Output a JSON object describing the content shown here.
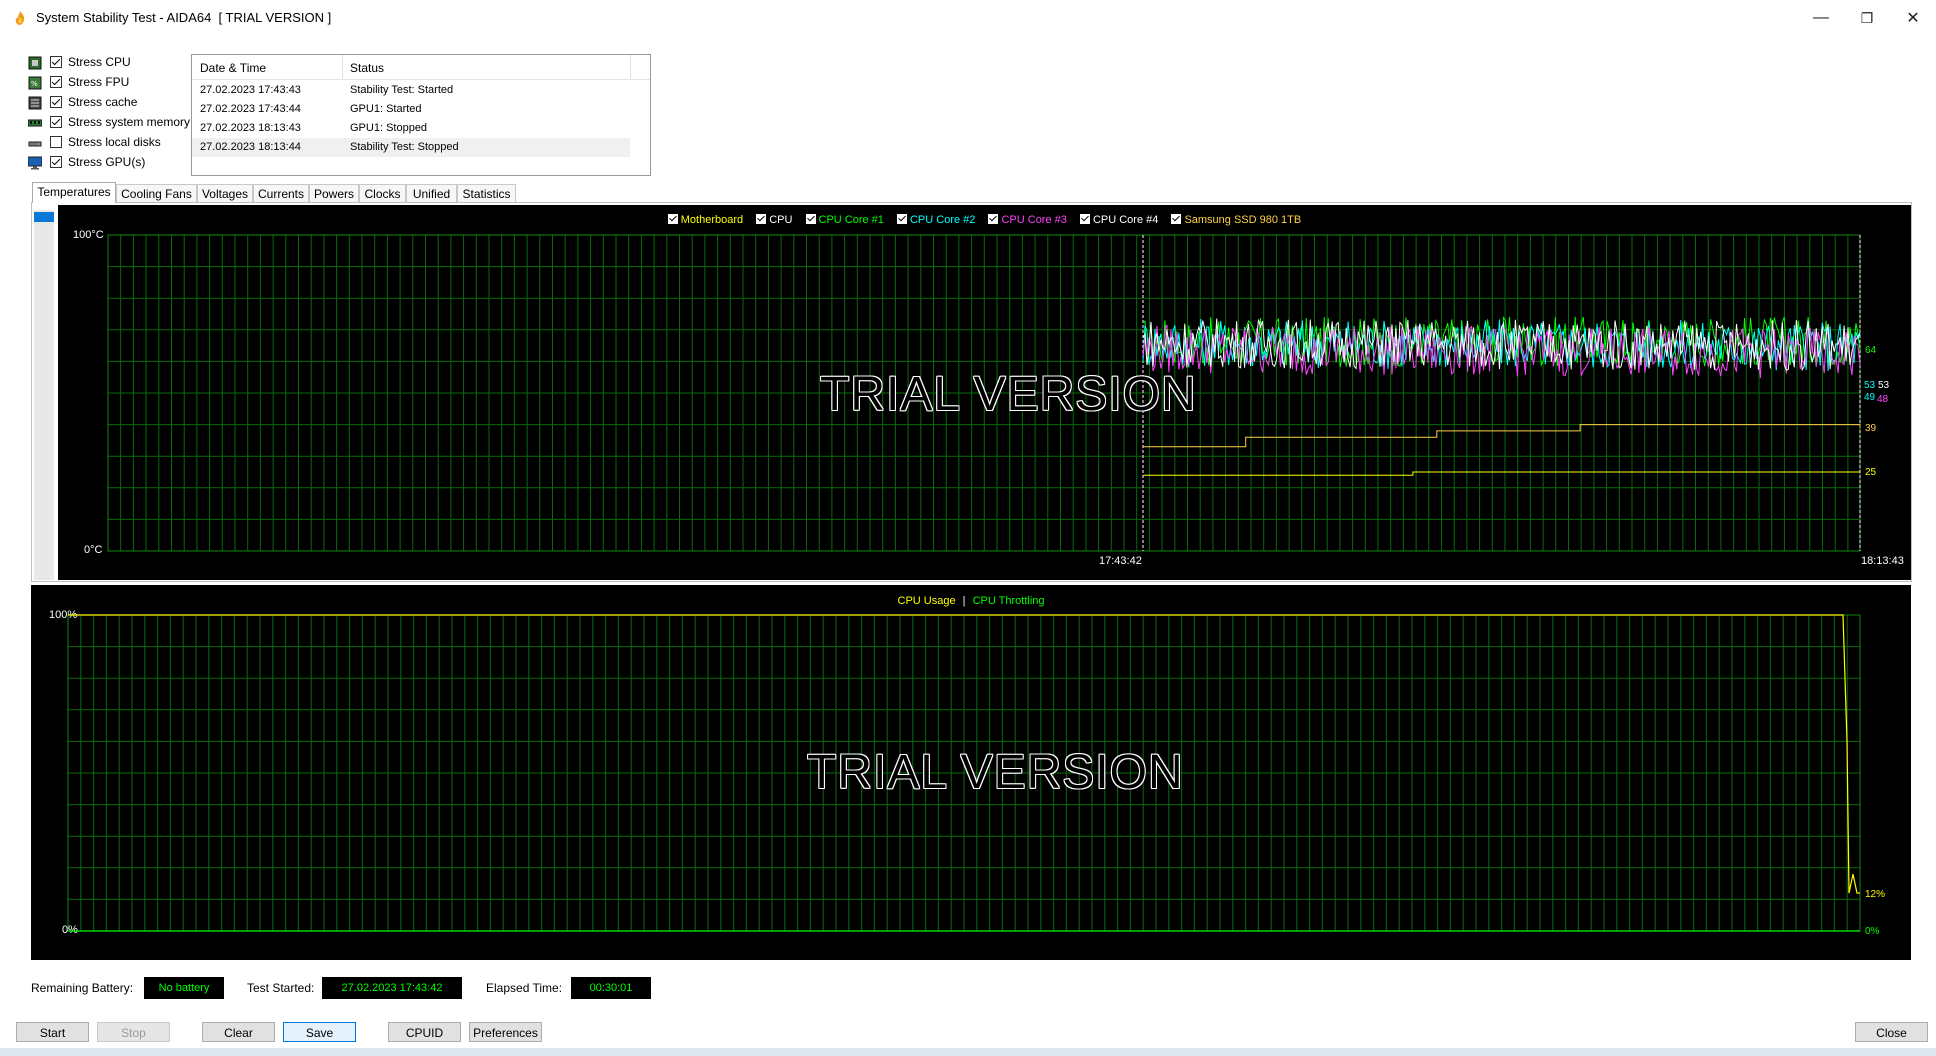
{
  "window": {
    "title": "System Stability Test - AIDA64  [ TRIAL VERSION ]",
    "minimize_glyph": "—",
    "maximize_glyph": "❐",
    "close_glyph": "✕"
  },
  "stress_options": [
    {
      "label": "Stress CPU",
      "checked": true,
      "icon": "cpu-chip-icon"
    },
    {
      "label": "Stress FPU",
      "checked": true,
      "icon": "fpu-chip-icon"
    },
    {
      "label": "Stress cache",
      "checked": true,
      "icon": "cache-chip-icon"
    },
    {
      "label": "Stress system memory",
      "checked": true,
      "icon": "memory-module-icon"
    },
    {
      "label": "Stress local disks",
      "checked": false,
      "icon": "disk-drive-icon"
    },
    {
      "label": "Stress GPU(s)",
      "checked": true,
      "icon": "monitor-gpu-icon"
    }
  ],
  "log": {
    "col_datetime": "Date & Time",
    "col_status": "Status",
    "rows": [
      {
        "datetime": "27.02.2023 17:43:43",
        "status": "Stability Test: Started"
      },
      {
        "datetime": "27.02.2023 17:43:44",
        "status": "GPU1: Started"
      },
      {
        "datetime": "27.02.2023 18:13:43",
        "status": "GPU1: Stopped"
      },
      {
        "datetime": "27.02.2023 18:13:44",
        "status": "Stability Test: Stopped"
      }
    ]
  },
  "tabs": [
    "Temperatures",
    "Cooling Fans",
    "Voltages",
    "Currents",
    "Powers",
    "Clocks",
    "Unified",
    "Statistics"
  ],
  "temp_graph": {
    "legend": [
      {
        "label": "Motherboard",
        "color": "#ffff00"
      },
      {
        "label": "CPU",
        "color": "#ffffff"
      },
      {
        "label": "CPU Core #1",
        "color": "#00ff00"
      },
      {
        "label": "CPU Core #2",
        "color": "#00ffff"
      },
      {
        "label": "CPU Core #3",
        "color": "#ff44ff"
      },
      {
        "label": "CPU Core #4",
        "color": "#ffffff"
      },
      {
        "label": "Samsung SSD 980 1TB",
        "color": "#ffd24a"
      }
    ],
    "y_top": "100°C",
    "y_bottom": "0°C",
    "x_start_time": "17:43:42",
    "x_end_time": "18:13:43",
    "watermark": "TRIAL VERSION",
    "end_values": [
      {
        "text": "64",
        "color": "#00ff00"
      },
      {
        "text": "53",
        "color": "#00ffff"
      },
      {
        "text": "53",
        "color": "#ffffff"
      },
      {
        "text": "49",
        "color": "#00ffff"
      },
      {
        "text": "48",
        "color": "#ff44ff"
      },
      {
        "text": "39",
        "color": "#ffd24a"
      },
      {
        "text": "25",
        "color": "#ffff00"
      }
    ]
  },
  "usage_graph": {
    "legend_usage": "CPU Usage",
    "legend_separator": "|",
    "legend_throttling": "CPU Throttling",
    "usage_color": "#ffff00",
    "throttling_color": "#00ff00",
    "y_top": "100%",
    "y_bottom": "0%",
    "watermark": "TRIAL VERSION",
    "end_usage": "12%",
    "end_throttling": "0%"
  },
  "chart_data": [
    {
      "type": "line",
      "y_unit": "°C",
      "ylim": [
        0,
        100
      ],
      "x_start": "17:43:42",
      "x_end": "18:13:43",
      "series": [
        {
          "name": "CPU Core #1",
          "color": "#00ff00",
          "x": [
            "17:43:42",
            "18:13:43"
          ],
          "values": [
            60,
            64
          ]
        },
        {
          "name": "CPU Core #2",
          "color": "#00ffff",
          "x": [
            "17:43:42",
            "18:13:43"
          ],
          "values": [
            60,
            53
          ]
        },
        {
          "name": "CPU Core #3",
          "color": "#ff44ff",
          "x": [
            "17:43:42",
            "18:13:43"
          ],
          "values": [
            58,
            48
          ]
        },
        {
          "name": "CPU",
          "color": "#ffffff",
          "x": [
            "17:43:42",
            "18:13:43"
          ],
          "values": [
            60,
            53
          ]
        },
        {
          "name": "Samsung SSD 980 1TB",
          "color": "#ffd24a",
          "x": [
            "17:43:42",
            "17:48:00",
            "17:56:00",
            "18:02:00",
            "18:13:43"
          ],
          "values": [
            33,
            36,
            38,
            40,
            39
          ]
        },
        {
          "name": "Motherboard",
          "color": "#ffff00",
          "x": [
            "17:43:42",
            "17:55:00",
            "18:13:43"
          ],
          "values": [
            24,
            25,
            25
          ]
        }
      ]
    },
    {
      "type": "line",
      "y_unit": "%",
      "ylim": [
        0,
        100
      ],
      "series": [
        {
          "name": "CPU Usage",
          "color": "#ffff00",
          "values": [
            100,
            100,
            100,
            12
          ]
        },
        {
          "name": "CPU Throttling",
          "color": "#00ff00",
          "values": [
            0,
            0,
            0,
            0
          ]
        }
      ]
    }
  ],
  "footer": {
    "battery_label": "Remaining Battery:",
    "battery_value": "No battery",
    "started_label": "Test Started:",
    "started_value": "27.02.2023 17:43:42",
    "elapsed_label": "Elapsed Time:",
    "elapsed_value": "00:30:01"
  },
  "buttons": {
    "start": "Start",
    "stop": "Stop",
    "clear": "Clear",
    "save": "Save",
    "cpuid": "CPUID",
    "preferences": "Preferences",
    "close": "Close"
  }
}
